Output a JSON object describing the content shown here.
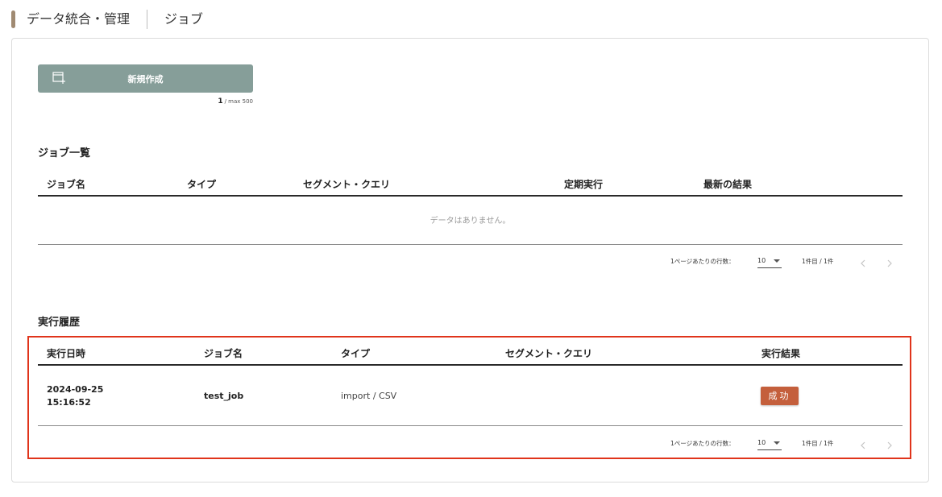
{
  "header": {
    "section": "データ統合・管理",
    "page": "ジョブ",
    "accent_color": "#a08a72"
  },
  "create": {
    "label": "新規作成",
    "icon": "new-window-icon",
    "count_current": "1",
    "count_max": "/ max 500"
  },
  "jobs": {
    "title": "ジョブ一覧",
    "columns": [
      "ジョブ名",
      "タイプ",
      "セグメント・クエリ",
      "定期実行",
      "最新の結果"
    ],
    "empty_message": "データはありません。",
    "pagination": {
      "rows_label": "1ページあたりの行数：",
      "rows_value": "10",
      "range": "1件目 / 1件"
    }
  },
  "history": {
    "title": "実行履歴",
    "columns": [
      "実行日時",
      "ジョブ名",
      "タイプ",
      "セグメント・クエリ",
      "実行結果"
    ],
    "rows": [
      {
        "date": "2024-09-25",
        "time": "15:16:52",
        "job_name": "test_job",
        "type": "import / CSV",
        "segment": "",
        "result": "成功",
        "result_color": "#c45f3c"
      }
    ],
    "pagination": {
      "rows_label": "1ページあたりの行数：",
      "rows_value": "10",
      "range": "1件目 / 1件"
    }
  }
}
